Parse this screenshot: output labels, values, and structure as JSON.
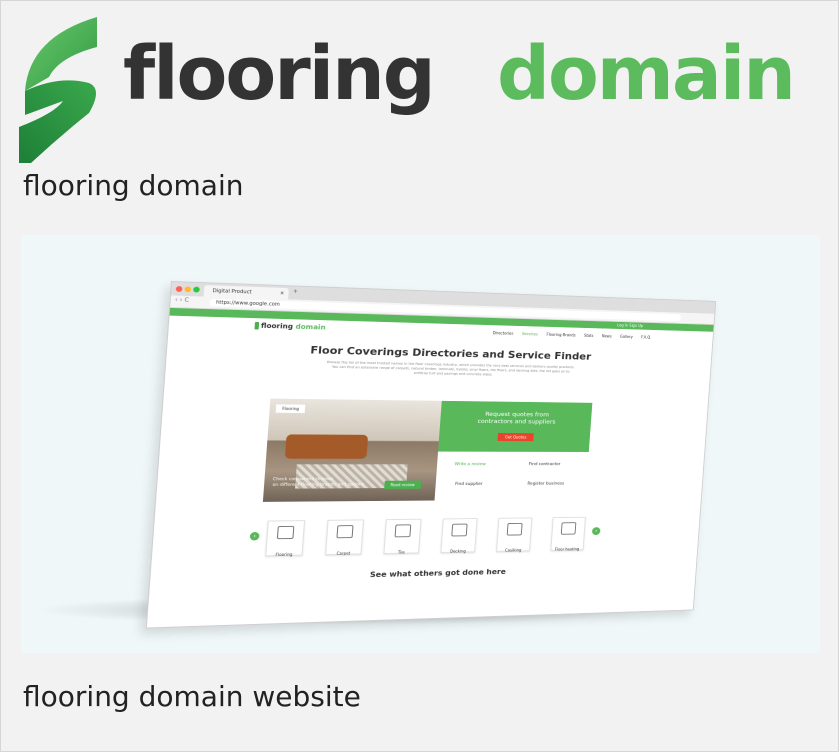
{
  "logo": {
    "word1": "flooring",
    "word2": "domain",
    "colors": {
      "dark": "#333333",
      "green": "#5cbb5c"
    }
  },
  "captions": {
    "logo_caption": "flooring domain",
    "image_caption": "flooring domain website"
  },
  "browser": {
    "tab_title": "Digital Product",
    "tab_close": "×",
    "new_tab": "+",
    "nav_buttons": "‹ › C",
    "url": "https://www.google.com"
  },
  "site": {
    "top_links": "Log In   Sign Up",
    "logo_word1": "flooring",
    "logo_word2": "domain",
    "menu": [
      "Directories",
      "Services",
      "Flooring Brands",
      "Stats",
      "News",
      "Gallery",
      "F.A.Q."
    ],
    "hero_title": "Floor Coverings Directories and Service Finder",
    "hero_sub": "Browse the list of the most trusted names in the floor coverings industry, which provides the very best services and delivers quality products. You can find an extensive range of carpets, natural timber, laminate, hybrid, vinyl floors, tile floors, and decking tiles, the list goes on to artificial turf and pavings and concrete slabs.",
    "photo_badge": "Flooring",
    "photo_text_1": "Check consumers reviews",
    "photo_text_2": "on different flooring brands and options",
    "read_button": "Read review",
    "quote_line1": "Request quotes from",
    "quote_line2": "contractors and suppliers",
    "quote_button": "Get Quotes",
    "links": {
      "write_review": "Write a review",
      "find_contractor": "Find contractor",
      "find_supplier": "Find supplier",
      "register_business": "Register business"
    },
    "categories": [
      "Flooring",
      "Carpet",
      "Tile",
      "Decking",
      "Caulking",
      "Floor heating"
    ],
    "see_heading": "See what others got done here"
  }
}
